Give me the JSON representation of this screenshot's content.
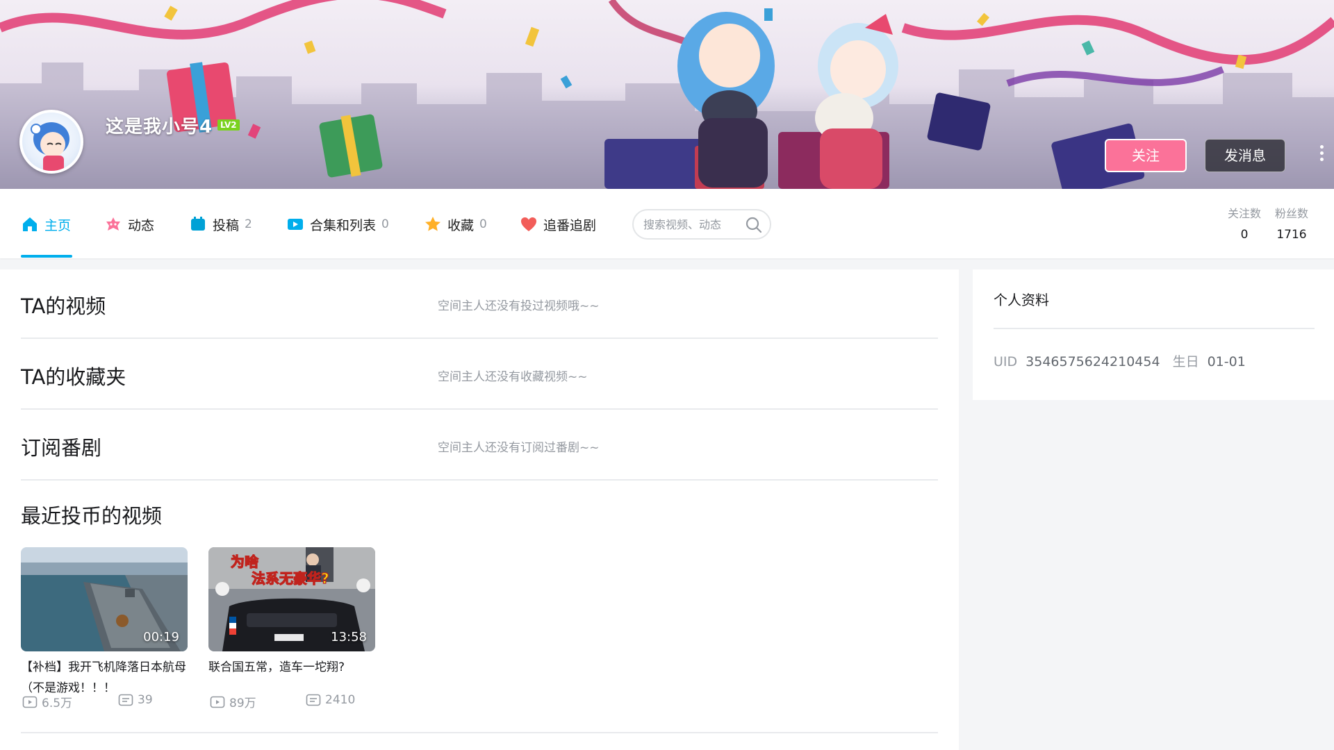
{
  "header": {
    "username": "这是我小号4",
    "level": "LV2",
    "follow_button": "关注",
    "message_button": "发消息"
  },
  "nav": {
    "tabs": [
      {
        "label": "主页",
        "count": "",
        "icon": "home-icon",
        "active": true
      },
      {
        "label": "动态",
        "count": "",
        "icon": "dynamic-icon",
        "active": false
      },
      {
        "label": "投稿",
        "count": "2",
        "icon": "upload-icon",
        "active": false
      },
      {
        "label": "合集和列表",
        "count": "0",
        "icon": "collection-icon",
        "active": false
      },
      {
        "label": "收藏",
        "count": "0",
        "icon": "star-icon",
        "active": false
      },
      {
        "label": "追番追剧",
        "count": "",
        "icon": "heart-icon",
        "active": false
      }
    ],
    "search_placeholder": "搜索视频、动态",
    "stats": [
      {
        "label": "关注数",
        "value": "0"
      },
      {
        "label": "粉丝数",
        "value": "1716"
      }
    ]
  },
  "main": {
    "sections": [
      {
        "title": "TA的视频",
        "empty_text": "空间主人还没有投过视频哦~~"
      },
      {
        "title": "TA的收藏夹",
        "empty_text": "空间主人还没有收藏视频~~"
      },
      {
        "title": "订阅番剧",
        "empty_text": "空间主人还没有订阅过番剧~~"
      }
    ],
    "coins_title": "最近投币的视频",
    "videos": [
      {
        "title": "【补档】我开飞机降落日本航母（不是游戏！！！",
        "duration": "00:19",
        "plays": "6.5万",
        "comments": "39"
      },
      {
        "title": "联合国五常，造车一坨翔?",
        "duration": "13:58",
        "plays": "89万",
        "comments": "2410",
        "thumb_text_1": "为啥",
        "thumb_text_2": "法系无豪华?"
      }
    ]
  },
  "profile": {
    "title": "个人资料",
    "uid_label": "UID",
    "uid": "3546575624210454",
    "birthday_label": "生日",
    "birthday": "01-01"
  },
  "colors": {
    "accent": "#00aeec",
    "follow": "#fb7299",
    "muted": "#9499a0"
  }
}
